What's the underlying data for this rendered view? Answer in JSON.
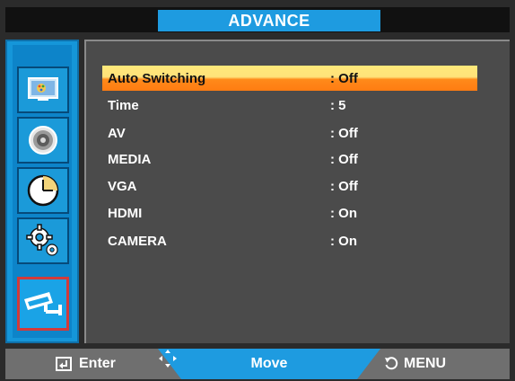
{
  "header": {
    "title": "ADVANCE"
  },
  "sidebar": {
    "items": [
      {
        "icon": "picture-icon"
      },
      {
        "icon": "sound-icon"
      },
      {
        "icon": "clock-icon"
      },
      {
        "icon": "settings-icon"
      },
      {
        "icon": "camera-icon",
        "active": true
      }
    ]
  },
  "menu": {
    "rows": [
      {
        "label": "Auto Switching",
        "value": ": Off",
        "selected": true
      },
      {
        "label": "Time",
        "value": ": 5"
      },
      {
        "label": "AV",
        "value": ": Off"
      },
      {
        "label": "MEDIA",
        "value": ": Off"
      },
      {
        "label": "VGA",
        "value": ": Off"
      },
      {
        "label": "HDMI",
        "value": ": On"
      },
      {
        "label": "CAMERA",
        "value": ": On"
      }
    ]
  },
  "footer": {
    "enter_label": "Enter",
    "move_label": "Move",
    "menu_label": "MENU"
  },
  "colors": {
    "accent_blue": "#1e9be0",
    "highlight_yellow": "#ffe97a",
    "highlight_orange": "#ff8a1a",
    "panel_gray": "#4b4b4b",
    "active_border": "#d23a3a"
  }
}
